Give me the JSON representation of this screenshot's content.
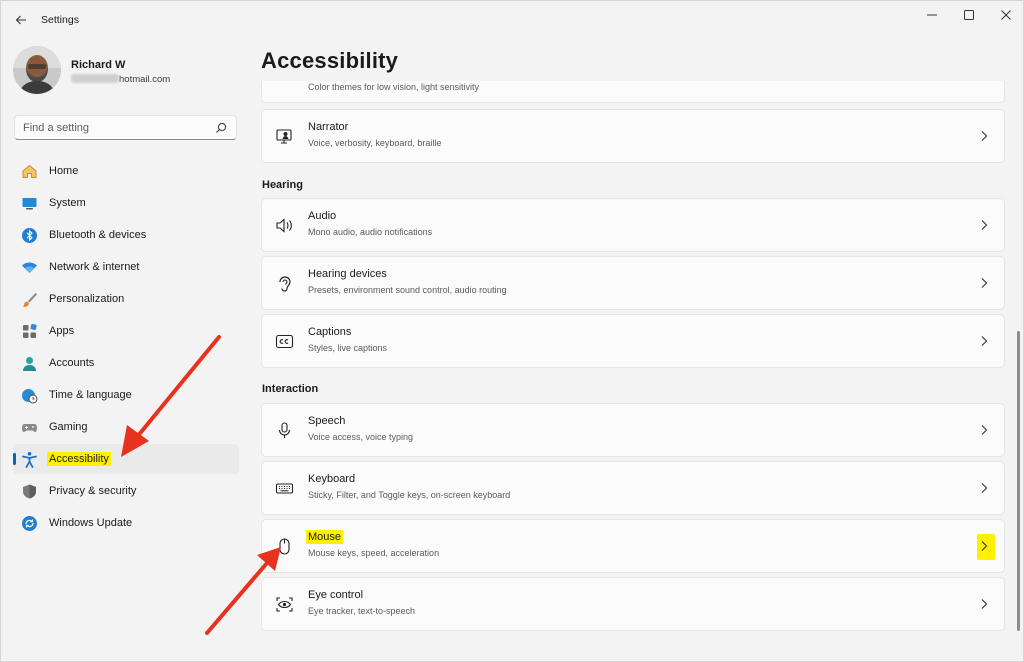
{
  "window": {
    "title": "Settings"
  },
  "profile": {
    "name": "Richard W",
    "email_suffix": "hotmail.com"
  },
  "search": {
    "placeholder": "Find a setting"
  },
  "nav": {
    "items": [
      {
        "label": "Home",
        "icon": "home-icon"
      },
      {
        "label": "System",
        "icon": "monitor-icon"
      },
      {
        "label": "Bluetooth & devices",
        "icon": "bluetooth-icon"
      },
      {
        "label": "Network & internet",
        "icon": "wifi-icon"
      },
      {
        "label": "Personalization",
        "icon": "brush-icon"
      },
      {
        "label": "Apps",
        "icon": "apps-icon"
      },
      {
        "label": "Accounts",
        "icon": "person-icon"
      },
      {
        "label": "Time & language",
        "icon": "globe-clock-icon"
      },
      {
        "label": "Gaming",
        "icon": "gamepad-icon"
      },
      {
        "label": "Accessibility",
        "icon": "accessibility-icon",
        "active": true
      },
      {
        "label": "Privacy & security",
        "icon": "shield-icon"
      },
      {
        "label": "Windows Update",
        "icon": "refresh-icon"
      }
    ]
  },
  "main": {
    "title": "Accessibility",
    "partial_card_sub": "Color themes for low vision, light sensitivity",
    "narrator": {
      "title": "Narrator",
      "sub": "Voice, verbosity, keyboard, braille"
    },
    "hearing_label": "Hearing",
    "hearing": [
      {
        "title": "Audio",
        "sub": "Mono audio, audio notifications"
      },
      {
        "title": "Hearing devices",
        "sub": "Presets, environment sound control, audio routing"
      },
      {
        "title": "Captions",
        "sub": "Styles, live captions"
      }
    ],
    "interaction_label": "Interaction",
    "interaction": [
      {
        "title": "Speech",
        "sub": "Voice access, voice typing"
      },
      {
        "title": "Keyboard",
        "sub": "Sticky, Filter, and Toggle keys, on-screen keyboard"
      },
      {
        "title": "Mouse",
        "sub": "Mouse keys, speed, acceleration"
      },
      {
        "title": "Eye control",
        "sub": "Eye tracker, text-to-speech"
      }
    ]
  },
  "colors": {
    "accent": "#0067c0",
    "highlight": "#fff000",
    "arrow": "#e8321e"
  }
}
